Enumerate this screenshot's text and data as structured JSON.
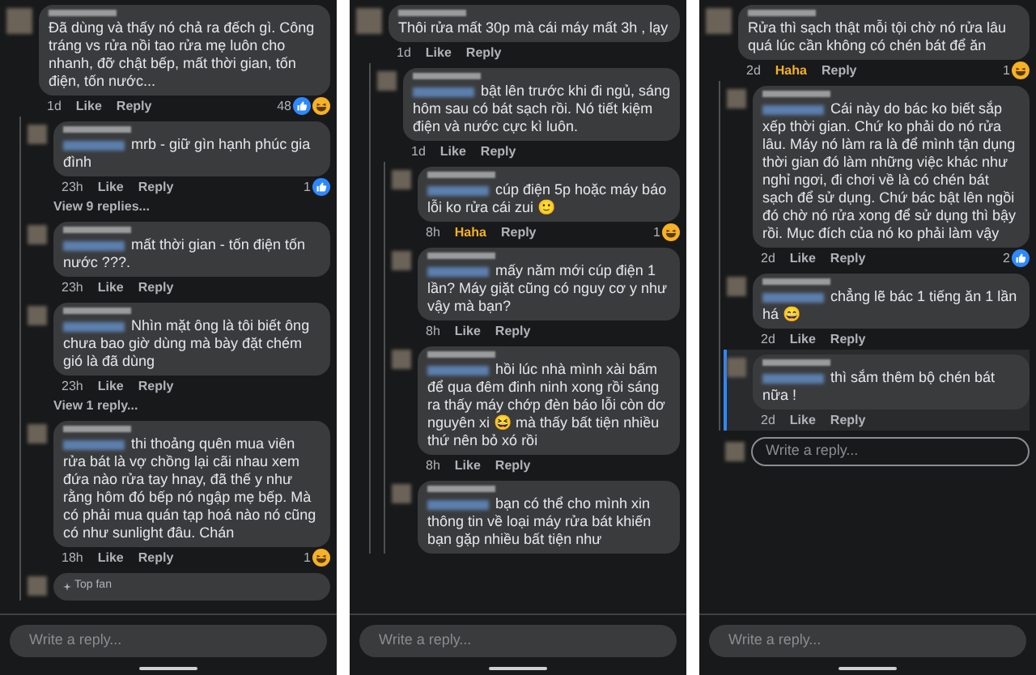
{
  "panels": [
    {
      "comments": [
        {
          "segments": [
            {
              "kind": "text",
              "value": "Đã dùng và thấy nó chả ra đếch gì. Công tráng vs rửa nồi tao rửa mẹ luôn cho nhanh, đỡ chật bếp, mất thời gian, tốn điện, tốn nước..."
            }
          ],
          "mention": false,
          "time": "1d",
          "actions": [
            {
              "label": "Like",
              "selected": false
            },
            {
              "label": "Reply",
              "selected": false
            }
          ],
          "reactions": {
            "count": "48",
            "icons": [
              {
                "kind": "like"
              },
              {
                "kind": "haha"
              }
            ]
          },
          "children": [
            {
              "segments": [
                {
                  "kind": "text",
                  "value": "mrb - giữ gìn hạnh phúc gia đình"
                }
              ],
              "mention": true,
              "time": "23h",
              "actions": [
                {
                  "label": "Like",
                  "selected": false
                },
                {
                  "label": "Reply",
                  "selected": false
                }
              ],
              "reactions": {
                "count": "1",
                "icons": [
                  {
                    "kind": "like"
                  }
                ]
              },
              "view_replies": "View 9 replies..."
            },
            {
              "segments": [
                {
                  "kind": "text",
                  "value": "mất thời gian - tốn điện tốn nước ???."
                }
              ],
              "mention": true,
              "time": "23h",
              "actions": [
                {
                  "label": "Like",
                  "selected": false
                },
                {
                  "label": "Reply",
                  "selected": false
                }
              ]
            },
            {
              "segments": [
                {
                  "kind": "text",
                  "value": "Nhìn mặt ông là tôi biết ông chưa bao giờ dùng mà bày đặt chém gió là đã dùng"
                }
              ],
              "mention": true,
              "time": "23h",
              "actions": [
                {
                  "label": "Like",
                  "selected": false
                },
                {
                  "label": "Reply",
                  "selected": false
                }
              ],
              "view_replies": "View 1 reply..."
            },
            {
              "segments": [
                {
                  "kind": "text",
                  "value": "thi thoảng quên mua viên rửa bát là vợ chồng lại cãi nhau xem đứa nào rửa tay hnay, đã thế y như rằng hôm đó bếp nó ngập mẹ bếp. Mà có phải mua quán tạp hoá nào nó cũng có như sunlight đâu. Chán"
                }
              ],
              "mention": true,
              "time": "18h",
              "actions": [
                {
                  "label": "Like",
                  "selected": false
                },
                {
                  "label": "Reply",
                  "selected": false
                }
              ],
              "reactions": {
                "count": "1",
                "icons": [
                  {
                    "kind": "haha"
                  }
                ]
              }
            },
            {
              "badge": "Top fan",
              "mention": false
            }
          ]
        }
      ],
      "composer": "Write a reply..."
    },
    {
      "comments": [
        {
          "segments": [
            {
              "kind": "text",
              "value": "Thôi rửa mất 30p mà cái máy mất 3h , lạy"
            }
          ],
          "mention": false,
          "time": "1d",
          "actions": [
            {
              "label": "Like",
              "selected": false
            },
            {
              "label": "Reply",
              "selected": false
            }
          ],
          "children": [
            {
              "segments": [
                {
                  "kind": "text",
                  "value": "bật lên trước khi đi ngủ, sáng hôm sau có bát sạch rồi. Nó tiết kiệm điện và nước cực kì luôn."
                }
              ],
              "mention": true,
              "time": "1d",
              "actions": [
                {
                  "label": "Like",
                  "selected": false
                },
                {
                  "label": "Reply",
                  "selected": false
                }
              ],
              "children": [
                {
                  "segments": [
                    {
                      "kind": "text",
                      "value": "cúp điện 5p hoặc máy báo lỗi ko rửa cái zui 🙂"
                    }
                  ],
                  "mention": true,
                  "time": "8h",
                  "actions": [
                    {
                      "label": "Haha",
                      "selected": true
                    },
                    {
                      "label": "Reply",
                      "selected": false
                    }
                  ],
                  "reactions": {
                    "count": "1",
                    "icons": [
                      {
                        "kind": "haha"
                      }
                    ]
                  }
                },
                {
                  "segments": [
                    {
                      "kind": "text",
                      "value": "mấy năm mới cúp điện 1 lần? Máy giặt cũng có nguy cơ y như vậy mà bạn?"
                    }
                  ],
                  "mention": true,
                  "time": "8h",
                  "actions": [
                    {
                      "label": "Like",
                      "selected": false
                    },
                    {
                      "label": "Reply",
                      "selected": false
                    }
                  ]
                },
                {
                  "segments": [
                    {
                      "kind": "text",
                      "value": "hồi lúc nhà mình xài bấm để qua đêm đinh ninh xong rồi sáng ra thấy máy chớp đèn báo lỗi còn dơ nguyên xi 😆 mà thấy bất tiện nhiều thứ nên bỏ xó rồi"
                    }
                  ],
                  "mention": true,
                  "time": "8h",
                  "actions": [
                    {
                      "label": "Like",
                      "selected": false
                    },
                    {
                      "label": "Reply",
                      "selected": false
                    }
                  ]
                },
                {
                  "segments": [
                    {
                      "kind": "text",
                      "value": "bạn có thể cho mình xin thông tin về loại máy rửa bát khiến bạn gặp nhiều bất tiện như"
                    }
                  ],
                  "mention": true
                }
              ]
            }
          ]
        }
      ],
      "composer": "Write a reply..."
    },
    {
      "comments": [
        {
          "segments": [
            {
              "kind": "text",
              "value": "Rửa thì sạch thật mỗi tội chờ nó rửa lâu quá lúc cần không có chén bát để ăn"
            }
          ],
          "mention": false,
          "time": "2d",
          "actions": [
            {
              "label": "Haha",
              "selected": true
            },
            {
              "label": "Reply",
              "selected": false
            }
          ],
          "reactions": {
            "count": "1",
            "icons": [
              {
                "kind": "haha"
              }
            ]
          },
          "children": [
            {
              "segments": [
                {
                  "kind": "text",
                  "value": "Cái này do bác ko biết sắp xếp thời gian. Chứ ko phải do nó rửa lâu. Máy nó làm ra là để mình tận dụng thời gian đó làm những việc khác như nghỉ ngơi, đi chơi về là có chén bát sạch để sử dụng. Chứ bác bật lên ngồi đó chờ nó rửa xong để sử dụng thì bậy rồi. Mục đích của nó ko phải làm vậy"
                }
              ],
              "mention": true,
              "time": "2d",
              "actions": [
                {
                  "label": "Like",
                  "selected": false
                },
                {
                  "label": "Reply",
                  "selected": false
                }
              ],
              "reactions": {
                "count": "2",
                "icons": [
                  {
                    "kind": "like"
                  }
                ]
              }
            },
            {
              "segments": [
                {
                  "kind": "text",
                  "value": "chẳng lẽ bác 1 tiếng ăn 1 lần há 😄"
                }
              ],
              "mention": true,
              "time": "2d",
              "actions": [
                {
                  "label": "Like",
                  "selected": false
                },
                {
                  "label": "Reply",
                  "selected": false
                }
              ]
            },
            {
              "segments": [
                {
                  "kind": "text",
                  "value": "thì sắm thêm bộ chén bát nữa !"
                }
              ],
              "mention": true,
              "highlighted": true,
              "time": "2d",
              "actions": [
                {
                  "label": "Like",
                  "selected": false
                },
                {
                  "label": "Reply",
                  "selected": false
                }
              ]
            }
          ],
          "reply_box": "Write a reply..."
        }
      ],
      "composer": "Write a reply..."
    }
  ]
}
